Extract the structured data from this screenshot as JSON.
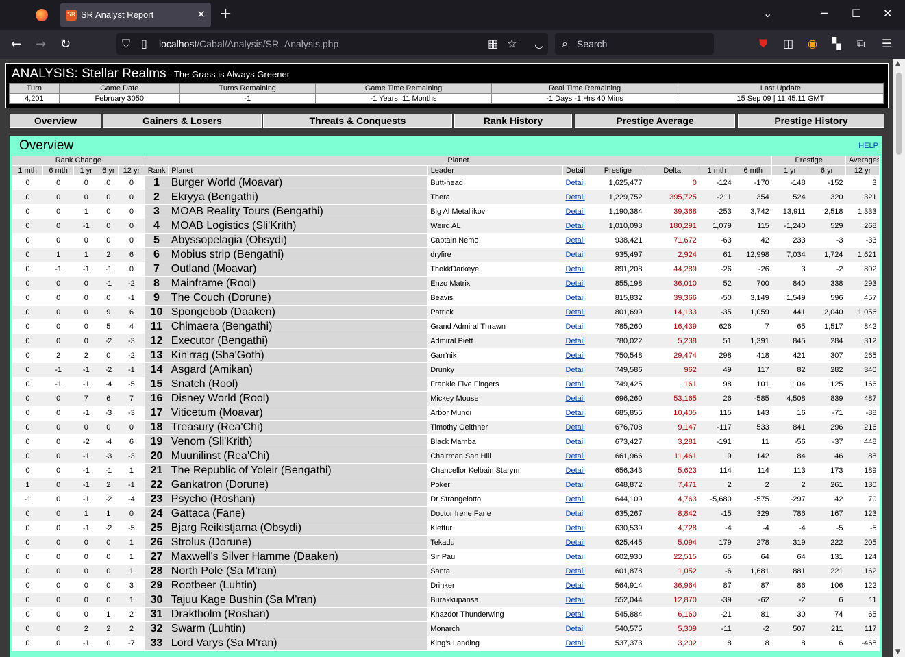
{
  "browser": {
    "tab_title": "SR Analyst Report",
    "tab_icon_text": "SR",
    "url_host": "localhost",
    "url_path": "/Cabal/Analysis/SR_Analysis.php",
    "search_placeholder": "Search"
  },
  "header": {
    "title": "ANALYSIS: Stellar Realms",
    "subtitle": " - The Grass is Always Greener",
    "status_headers": [
      "Turn",
      "Game Date",
      "Turns Remaining",
      "Game Time Remaining",
      "Real Time Remaining",
      "Last Update"
    ],
    "status_values": [
      "4,201",
      "February 3050",
      "-1",
      "-1 Years, 11 Months",
      "-1 Days -1 Hrs 40 Mins",
      "15 Sep 09 | 11:45:11 GMT"
    ]
  },
  "nav": [
    "Overview",
    "Gainers & Losers",
    "Threats & Conquests",
    "Rank History",
    "Prestige Average",
    "Prestige History"
  ],
  "panel": {
    "title": "Overview",
    "help": "HELP",
    "group_headers": {
      "rank_change": "Rank Change",
      "planet": "Planet",
      "prestige": "Prestige",
      "averages": "Averages"
    },
    "columns": [
      "1 mth",
      "6 mth",
      "1 yr",
      "6 yr",
      "12 yr",
      "Rank",
      "Planet",
      "Leader",
      "Detail",
      "Prestige",
      "Delta",
      "1 mth",
      "6 mth",
      "1 yr",
      "6 yr",
      "12 yr"
    ],
    "detail_label": "Detail",
    "rows": [
      {
        "rc": [
          "0",
          "0",
          "0",
          "0",
          "0"
        ],
        "rank": "1",
        "planet": "Burger World (Moavar)",
        "leader": "Butt-head",
        "prestige": "1,625,477",
        "delta": "0",
        "pr": [
          "-124",
          "-170",
          "-148"
        ],
        "avg": [
          "-152",
          "3"
        ]
      },
      {
        "rc": [
          "0",
          "0",
          "0",
          "0",
          "0"
        ],
        "rank": "2",
        "planet": "Ekryya (Bengathi)",
        "leader": "Thera",
        "prestige": "1,229,752",
        "delta": "395,725",
        "pr": [
          "-211",
          "354",
          "524"
        ],
        "avg": [
          "320",
          "321"
        ]
      },
      {
        "rc": [
          "0",
          "0",
          "1",
          "0",
          "0"
        ],
        "rank": "3",
        "planet": "MOAB Reality Tours (Bengathi)",
        "leader": "Big Al Metallikov",
        "prestige": "1,190,384",
        "delta": "39,368",
        "pr": [
          "-253",
          "3,742",
          "13,911"
        ],
        "avg": [
          "2,518",
          "1,333"
        ]
      },
      {
        "rc": [
          "0",
          "0",
          "-1",
          "0",
          "0"
        ],
        "rank": "4",
        "planet": "MOAB Logistics (Sli'Krith)",
        "leader": "Weird AL",
        "prestige": "1,010,093",
        "delta": "180,291",
        "pr": [
          "1,079",
          "115",
          "-1,240"
        ],
        "avg": [
          "529",
          "268"
        ]
      },
      {
        "rc": [
          "0",
          "0",
          "0",
          "0",
          "0"
        ],
        "rank": "5",
        "planet": "Abyssopelagia (Obsydi)",
        "leader": "Captain Nemo",
        "prestige": "938,421",
        "delta": "71,672",
        "pr": [
          "-63",
          "42",
          "233"
        ],
        "avg": [
          "-3",
          "-33"
        ]
      },
      {
        "rc": [
          "0",
          "1",
          "1",
          "2",
          "6"
        ],
        "rank": "6",
        "planet": "Mobius strip (Bengathi)",
        "leader": "dryfire",
        "prestige": "935,497",
        "delta": "2,924",
        "pr": [
          "61",
          "12,998",
          "7,034"
        ],
        "avg": [
          "1,724",
          "1,621"
        ]
      },
      {
        "rc": [
          "0",
          "-1",
          "-1",
          "-1",
          "0"
        ],
        "rank": "7",
        "planet": "Outland (Moavar)",
        "leader": "ThokkDarkeye",
        "prestige": "891,208",
        "delta": "44,289",
        "pr": [
          "-26",
          "-26",
          "3"
        ],
        "avg": [
          "-2",
          "802"
        ]
      },
      {
        "rc": [
          "0",
          "0",
          "0",
          "-1",
          "-2"
        ],
        "rank": "8",
        "planet": "Mainframe (Rool)",
        "leader": "Enzo Matrix",
        "prestige": "855,198",
        "delta": "36,010",
        "pr": [
          "52",
          "700",
          "840"
        ],
        "avg": [
          "338",
          "293"
        ]
      },
      {
        "rc": [
          "0",
          "0",
          "0",
          "0",
          "-1"
        ],
        "rank": "9",
        "planet": "The Couch (Dorune)",
        "leader": "Beavis",
        "prestige": "815,832",
        "delta": "39,366",
        "pr": [
          "-50",
          "3,149",
          "1,549"
        ],
        "avg": [
          "596",
          "457"
        ]
      },
      {
        "rc": [
          "0",
          "0",
          "0",
          "9",
          "6"
        ],
        "rank": "10",
        "planet": "Spongebob (Daaken)",
        "leader": "Patrick",
        "prestige": "801,699",
        "delta": "14,133",
        "pr": [
          "-35",
          "1,059",
          "441"
        ],
        "avg": [
          "2,040",
          "1,056"
        ]
      },
      {
        "rc": [
          "0",
          "0",
          "0",
          "5",
          "4"
        ],
        "rank": "11",
        "planet": "Chimaera (Bengathi)",
        "leader": "Grand Admiral Thrawn",
        "prestige": "785,260",
        "delta": "16,439",
        "pr": [
          "626",
          "7",
          "65"
        ],
        "avg": [
          "1,517",
          "842"
        ]
      },
      {
        "rc": [
          "0",
          "0",
          "0",
          "-2",
          "-3"
        ],
        "rank": "12",
        "planet": "Executor (Bengathi)",
        "leader": "Admiral Piett",
        "prestige": "780,022",
        "delta": "5,238",
        "pr": [
          "51",
          "1,391",
          "845"
        ],
        "avg": [
          "284",
          "312"
        ]
      },
      {
        "rc": [
          "0",
          "2",
          "2",
          "0",
          "-2"
        ],
        "rank": "13",
        "planet": "Kin'rrag (Sha'Goth)",
        "leader": "Garr'nik",
        "prestige": "750,548",
        "delta": "29,474",
        "pr": [
          "298",
          "418",
          "421"
        ],
        "avg": [
          "307",
          "265"
        ]
      },
      {
        "rc": [
          "0",
          "-1",
          "-1",
          "-2",
          "-1"
        ],
        "rank": "14",
        "planet": "Asgard (Amikan)",
        "leader": "Drunky",
        "prestige": "749,586",
        "delta": "962",
        "pr": [
          "49",
          "117",
          "82"
        ],
        "avg": [
          "282",
          "340"
        ]
      },
      {
        "rc": [
          "0",
          "-1",
          "-1",
          "-4",
          "-5"
        ],
        "rank": "15",
        "planet": "Snatch (Rool)",
        "leader": "Frankie Five Fingers",
        "prestige": "749,425",
        "delta": "161",
        "pr": [
          "98",
          "101",
          "104"
        ],
        "avg": [
          "125",
          "166"
        ]
      },
      {
        "rc": [
          "0",
          "0",
          "7",
          "6",
          "7"
        ],
        "rank": "16",
        "planet": "Disney World (Rool)",
        "leader": "Mickey Mouse",
        "prestige": "696,260",
        "delta": "53,165",
        "pr": [
          "26",
          "-585",
          "4,508"
        ],
        "avg": [
          "839",
          "487"
        ]
      },
      {
        "rc": [
          "0",
          "0",
          "-1",
          "-3",
          "-3"
        ],
        "rank": "17",
        "planet": "Viticetum (Moavar)",
        "leader": "Arbor Mundi",
        "prestige": "685,855",
        "delta": "10,405",
        "pr": [
          "115",
          "143",
          "16"
        ],
        "avg": [
          "-71",
          "-88"
        ]
      },
      {
        "rc": [
          "0",
          "0",
          "0",
          "0",
          "0"
        ],
        "rank": "18",
        "planet": "Treasury (Rea'Chi)",
        "leader": "Timothy Geithner",
        "prestige": "676,708",
        "delta": "9,147",
        "pr": [
          "-117",
          "533",
          "841"
        ],
        "avg": [
          "296",
          "216"
        ]
      },
      {
        "rc": [
          "0",
          "0",
          "-2",
          "-4",
          "6"
        ],
        "rank": "19",
        "planet": "Venom (Sli'Krith)",
        "leader": "Black Mamba",
        "prestige": "673,427",
        "delta": "3,281",
        "pr": [
          "-191",
          "11",
          "-56"
        ],
        "avg": [
          "-37",
          "448"
        ]
      },
      {
        "rc": [
          "0",
          "0",
          "-1",
          "-3",
          "-3"
        ],
        "rank": "20",
        "planet": "Muunilinst (Rea'Chi)",
        "leader": "Chairman San Hill",
        "prestige": "661,966",
        "delta": "11,461",
        "pr": [
          "9",
          "142",
          "84"
        ],
        "avg": [
          "46",
          "88"
        ]
      },
      {
        "rc": [
          "0",
          "0",
          "-1",
          "-1",
          "1"
        ],
        "rank": "21",
        "planet": "The Republic of Yoleir (Bengathi)",
        "leader": "Chancellor Kelbain Starym",
        "prestige": "656,343",
        "delta": "5,623",
        "pr": [
          "114",
          "114",
          "113"
        ],
        "avg": [
          "173",
          "189"
        ]
      },
      {
        "rc": [
          "1",
          "0",
          "-1",
          "2",
          "-1"
        ],
        "rank": "22",
        "planet": "Gankatron (Dorune)",
        "leader": "Poker",
        "prestige": "648,872",
        "delta": "7,471",
        "pr": [
          "2",
          "2",
          "2"
        ],
        "avg": [
          "261",
          "130"
        ]
      },
      {
        "rc": [
          "-1",
          "0",
          "-1",
          "-2",
          "-4"
        ],
        "rank": "23",
        "planet": "Psycho (Roshan)",
        "leader": "Dr Strangelotto",
        "prestige": "644,109",
        "delta": "4,763",
        "pr": [
          "-5,680",
          "-575",
          "-297"
        ],
        "avg": [
          "42",
          "70"
        ]
      },
      {
        "rc": [
          "0",
          "0",
          "1",
          "1",
          "0"
        ],
        "rank": "24",
        "planet": "Gattaca (Fane)",
        "leader": "Doctor Irene Fane",
        "prestige": "635,267",
        "delta": "8,842",
        "pr": [
          "-15",
          "329",
          "786"
        ],
        "avg": [
          "167",
          "123"
        ]
      },
      {
        "rc": [
          "0",
          "0",
          "-1",
          "-2",
          "-5"
        ],
        "rank": "25",
        "planet": "Bjarg Reikistjarna (Obsydi)",
        "leader": "Klettur",
        "prestige": "630,539",
        "delta": "4,728",
        "pr": [
          "-4",
          "-4",
          "-4"
        ],
        "avg": [
          "-5",
          "-5"
        ]
      },
      {
        "rc": [
          "0",
          "0",
          "0",
          "0",
          "1"
        ],
        "rank": "26",
        "planet": "Strolus (Dorune)",
        "leader": "Tekadu",
        "prestige": "625,445",
        "delta": "5,094",
        "pr": [
          "179",
          "278",
          "319"
        ],
        "avg": [
          "222",
          "205"
        ]
      },
      {
        "rc": [
          "0",
          "0",
          "0",
          "0",
          "1"
        ],
        "rank": "27",
        "planet": "Maxwell's Silver Hamme (Daaken)",
        "leader": "Sir Paul",
        "prestige": "602,930",
        "delta": "22,515",
        "pr": [
          "65",
          "64",
          "64"
        ],
        "avg": [
          "131",
          "124"
        ]
      },
      {
        "rc": [
          "0",
          "0",
          "0",
          "0",
          "1"
        ],
        "rank": "28",
        "planet": "North Pole (Sa M'ran)",
        "leader": "Santa",
        "prestige": "601,878",
        "delta": "1,052",
        "pr": [
          "-6",
          "1,681",
          "881"
        ],
        "avg": [
          "221",
          "162"
        ]
      },
      {
        "rc": [
          "0",
          "0",
          "0",
          "0",
          "3"
        ],
        "rank": "29",
        "planet": "Rootbeer (Luhtin)",
        "leader": "Drinker",
        "prestige": "564,914",
        "delta": "36,964",
        "pr": [
          "87",
          "87",
          "86"
        ],
        "avg": [
          "106",
          "122"
        ]
      },
      {
        "rc": [
          "0",
          "0",
          "0",
          "0",
          "1"
        ],
        "rank": "30",
        "planet": "Tajuu Kage Bushin (Sa M'ran)",
        "leader": "Burakkupansa",
        "prestige": "552,044",
        "delta": "12,870",
        "pr": [
          "-39",
          "-62",
          "-2"
        ],
        "avg": [
          "6",
          "11"
        ]
      },
      {
        "rc": [
          "0",
          "0",
          "0",
          "1",
          "2"
        ],
        "rank": "31",
        "planet": "Draktholm (Roshan)",
        "leader": "Khazdor Thunderwing",
        "prestige": "545,884",
        "delta": "6,160",
        "pr": [
          "-21",
          "81",
          "30"
        ],
        "avg": [
          "74",
          "65"
        ]
      },
      {
        "rc": [
          "0",
          "0",
          "2",
          "2",
          "2"
        ],
        "rank": "32",
        "planet": "Swarm (Luhtin)",
        "leader": "Monarch",
        "prestige": "540,575",
        "delta": "5,309",
        "pr": [
          "-11",
          "-2",
          "507"
        ],
        "avg": [
          "211",
          "117"
        ]
      },
      {
        "rc": [
          "0",
          "0",
          "-1",
          "0",
          "-7"
        ],
        "rank": "33",
        "planet": "Lord Varys (Sa M'ran)",
        "leader": "King's Landing",
        "prestige": "537,373",
        "delta": "3,202",
        "pr": [
          "8",
          "8",
          "8"
        ],
        "avg": [
          "6",
          "-468"
        ]
      }
    ]
  }
}
